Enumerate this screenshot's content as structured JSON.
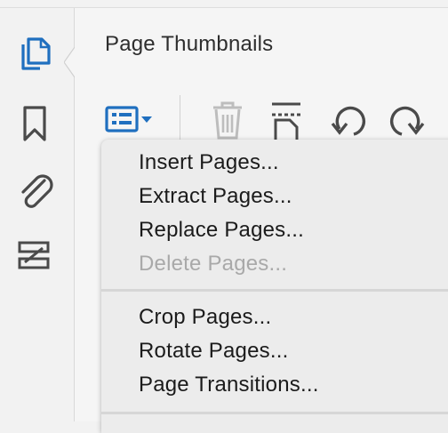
{
  "panel": {
    "title": "Page Thumbnails"
  },
  "sidebar": {
    "items": [
      {
        "name": "page-thumbnails",
        "icon": "pages-icon",
        "active": true
      },
      {
        "name": "bookmarks",
        "icon": "bookmark-icon",
        "active": false
      },
      {
        "name": "attachments",
        "icon": "paperclip-icon",
        "active": false
      },
      {
        "name": "layers",
        "icon": "layers-icon",
        "active": false
      }
    ]
  },
  "toolbar": {
    "tools": [
      {
        "name": "options-menu",
        "icon": "list-menu-icon"
      },
      {
        "name": "delete",
        "icon": "trash-icon"
      },
      {
        "name": "insert",
        "icon": "insert-page-icon"
      },
      {
        "name": "rotate-left",
        "icon": "rotate-ccw-icon"
      },
      {
        "name": "rotate-right",
        "icon": "rotate-cw-icon"
      }
    ]
  },
  "menu": {
    "group1": [
      {
        "label": "Insert Pages...",
        "enabled": true
      },
      {
        "label": "Extract Pages...",
        "enabled": true
      },
      {
        "label": "Replace Pages...",
        "enabled": true
      },
      {
        "label": "Delete Pages...",
        "enabled": false
      }
    ],
    "group2": [
      {
        "label": "Crop Pages...",
        "enabled": true
      },
      {
        "label": "Rotate Pages...",
        "enabled": true
      },
      {
        "label": "Page Transitions...",
        "enabled": true
      }
    ]
  },
  "colors": {
    "accent": "#1f6fbf",
    "icon_gray": "#4a4a4a",
    "disabled_text": "#a9a9a9"
  }
}
